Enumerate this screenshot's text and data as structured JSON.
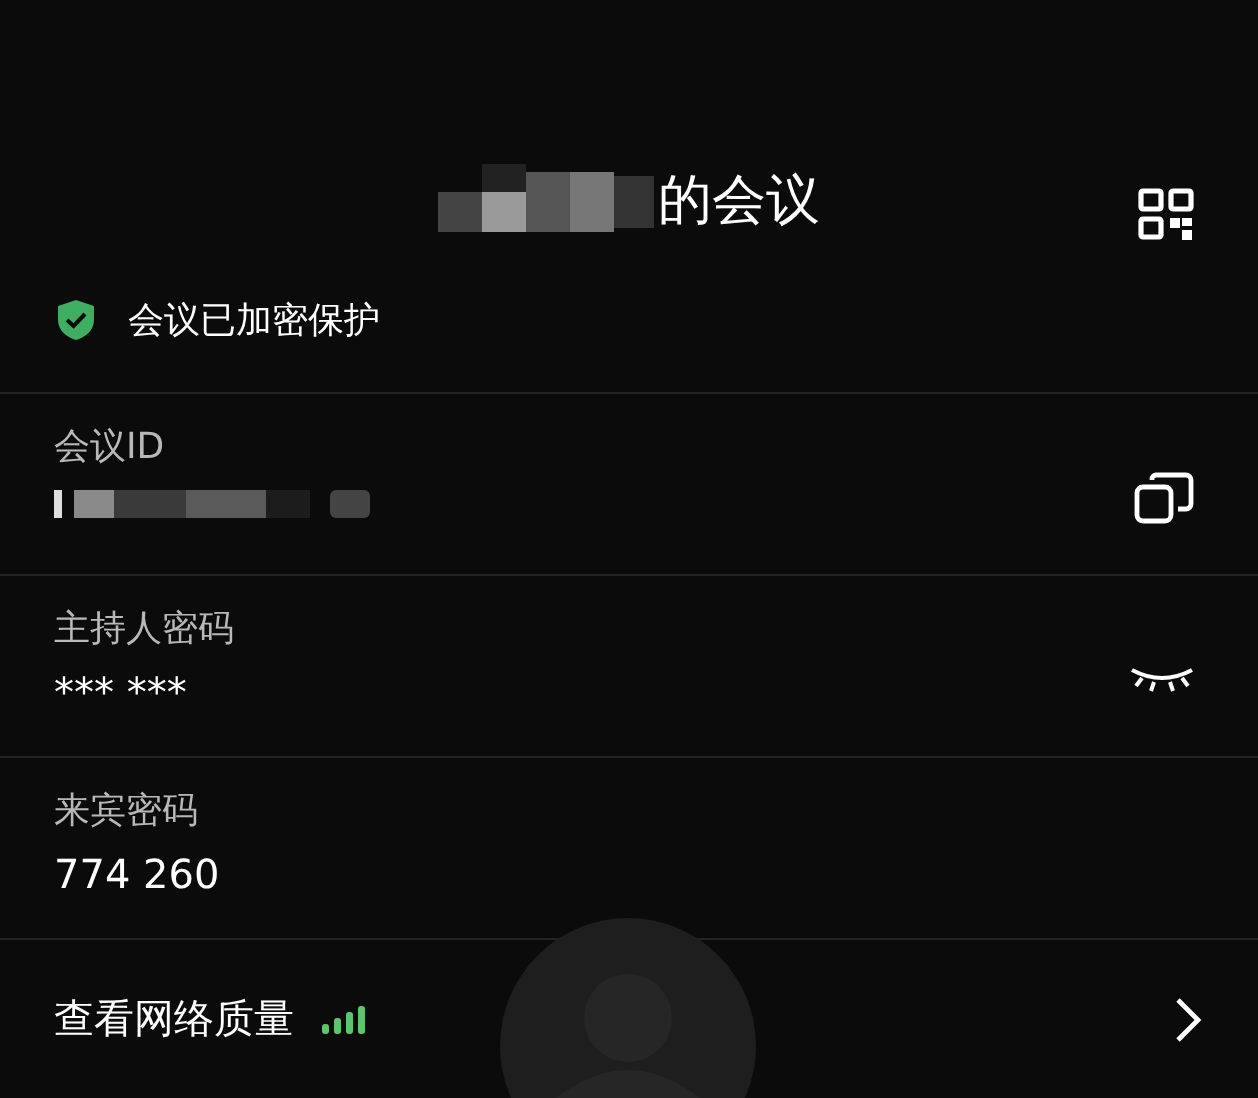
{
  "header": {
    "title": "的会议",
    "title_redacted": true
  },
  "security": {
    "label": "会议已加密保护"
  },
  "fields": [
    {
      "kind": "copy",
      "label": "会议ID",
      "redacted": true
    },
    {
      "kind": "reveal",
      "label": "主持人密码",
      "value": "*** ***",
      "redacted": false
    },
    {
      "kind": "plain",
      "label": "来宾密码",
      "value": "774 260",
      "redacted": false
    }
  ],
  "network": {
    "label": "查看网络质量"
  }
}
